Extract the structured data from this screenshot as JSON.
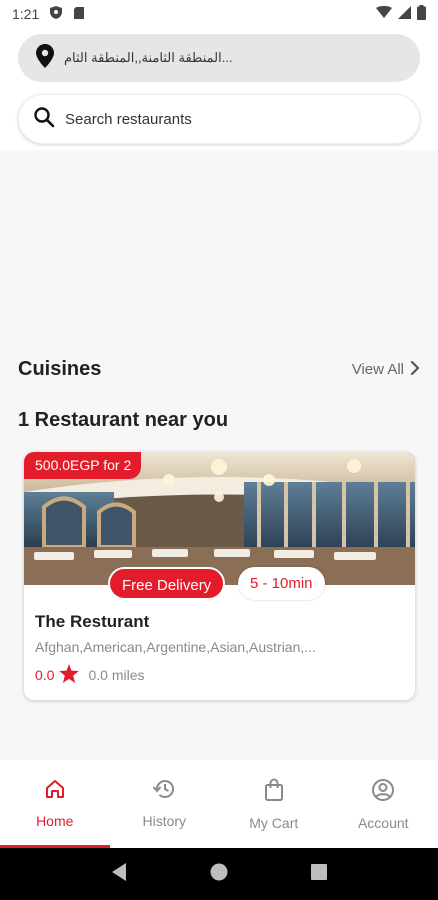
{
  "status_bar": {
    "time": "1:21"
  },
  "location": {
    "text": "المنطقة الثامنة,,المنطقة الثام..."
  },
  "search": {
    "placeholder": "Search restaurants"
  },
  "cuisines": {
    "title": "Cuisines",
    "view_all": "View All"
  },
  "restaurants_section": {
    "title": "1 Restaurant near you"
  },
  "restaurant": {
    "price_badge": "500.0EGP for 2",
    "delivery_tag": "Free Delivery",
    "delivery_time": "5 - 10min",
    "name": "The Resturant",
    "cuisines": "Afghan,American,Argentine,Asian,Austrian,...",
    "rating": "0.0",
    "distance": "0.0 miles"
  },
  "bottom_nav": {
    "items": [
      {
        "label": "Home",
        "icon": "home-icon"
      },
      {
        "label": "History",
        "icon": "history-icon"
      },
      {
        "label": "My Cart",
        "icon": "shopping-bag-icon"
      },
      {
        "label": "Account",
        "icon": "account-icon"
      }
    ],
    "active": "Home"
  },
  "colors": {
    "accent": "#e21c2b",
    "muted": "#8a8a8a",
    "background": "#f7f7f7"
  }
}
